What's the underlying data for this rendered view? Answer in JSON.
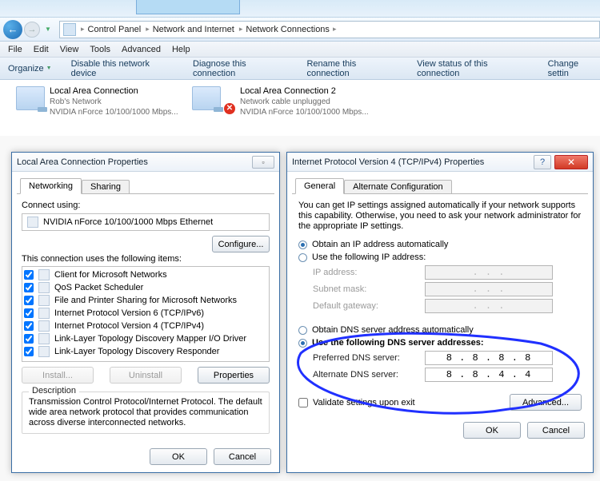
{
  "top": {
    "win_preview": ""
  },
  "breadcrumb": {
    "items": [
      "Control Panel",
      "Network and Internet",
      "Network Connections"
    ]
  },
  "menu": {
    "file": "File",
    "edit": "Edit",
    "view": "View",
    "tools": "Tools",
    "advanced": "Advanced",
    "help": "Help"
  },
  "cmd": {
    "organize": "Organize",
    "disable": "Disable this network device",
    "diagnose": "Diagnose this connection",
    "rename": "Rename this connection",
    "viewstatus": "View status of this connection",
    "change": "Change settin"
  },
  "conn1": {
    "title": "Local Area Connection",
    "net": "Rob's Network",
    "dev": "NVIDIA nForce 10/100/1000 Mbps..."
  },
  "conn2": {
    "title": "Local Area Connection 2",
    "net": "Network cable unplugged",
    "dev": "NVIDIA nForce 10/100/1000 Mbps..."
  },
  "dlg1": {
    "title": "Local Area Connection Properties",
    "tabs": {
      "networking": "Networking",
      "sharing": "Sharing"
    },
    "connect_using": "Connect using:",
    "adapter": "NVIDIA nForce 10/100/1000 Mbps Ethernet",
    "configure": "Configure...",
    "items_label": "This connection uses the following items:",
    "items": [
      "Client for Microsoft Networks",
      "QoS Packet Scheduler",
      "File and Printer Sharing for Microsoft Networks",
      "Internet Protocol Version 6 (TCP/IPv6)",
      "Internet Protocol Version 4 (TCP/IPv4)",
      "Link-Layer Topology Discovery Mapper I/O Driver",
      "Link-Layer Topology Discovery Responder"
    ],
    "install": "Install...",
    "uninstall": "Uninstall",
    "properties": "Properties",
    "desc_label": "Description",
    "desc_text": "Transmission Control Protocol/Internet Protocol. The default wide area network protocol that provides communication across diverse interconnected networks.",
    "ok": "OK",
    "cancel": "Cancel"
  },
  "dlg2": {
    "title": "Internet Protocol Version 4 (TCP/IPv4) Properties",
    "tabs": {
      "general": "General",
      "alt": "Alternate Configuration"
    },
    "info": "You can get IP settings assigned automatically if your network supports this capability. Otherwise, you need to ask your network administrator for the appropriate IP settings.",
    "r_ip_auto": "Obtain an IP address automatically",
    "r_ip_manual": "Use the following IP address:",
    "ip_label": "IP address:",
    "subnet_label": "Subnet mask:",
    "gw_label": "Default gateway:",
    "r_dns_auto": "Obtain DNS server address automatically",
    "r_dns_manual": "Use the following DNS server addresses:",
    "pref_label": "Preferred DNS server:",
    "alt_label": "Alternate DNS server:",
    "pref_dns": "8 . 8 . 8 . 8",
    "alt_dns": "8 . 8 . 4 . 4",
    "validate": "Validate settings upon exit",
    "advanced": "Advanced...",
    "ok": "OK",
    "cancel": "Cancel",
    "dots": ".     .     ."
  }
}
